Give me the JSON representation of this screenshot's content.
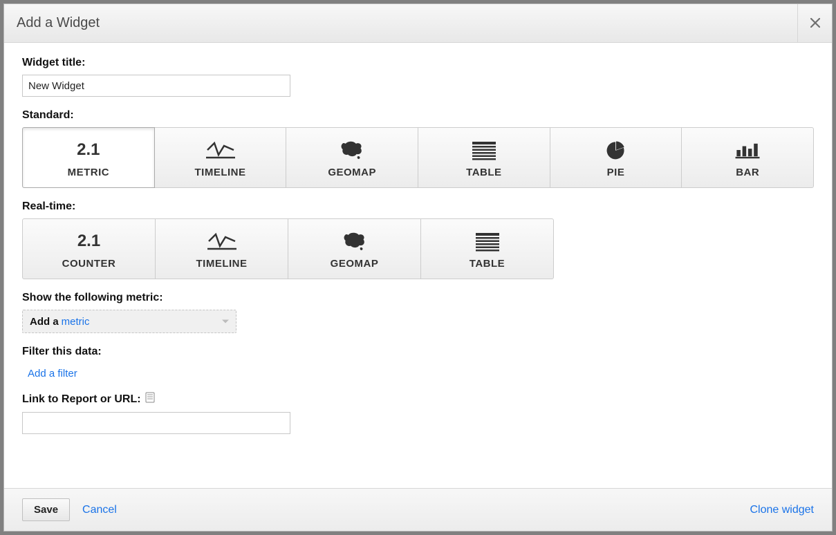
{
  "dialog": {
    "title": "Add a Widget"
  },
  "widget_title": {
    "label": "Widget title:",
    "value": "New Widget"
  },
  "standard": {
    "label": "Standard:",
    "options": {
      "metric": "METRIC",
      "timeline": "TIMELINE",
      "geomap": "GEOMAP",
      "table": "TABLE",
      "pie": "PIE",
      "bar": "BAR"
    },
    "selected": "metric"
  },
  "realtime": {
    "label": "Real-time:",
    "options": {
      "counter": "COUNTER",
      "timeline": "TIMELINE",
      "geomap": "GEOMAP",
      "table": "TABLE"
    }
  },
  "metric": {
    "label": "Show the following metric:",
    "add_prefix": "Add a",
    "add_link": "metric"
  },
  "filter": {
    "label": "Filter this data:",
    "add_filter": "Add a filter"
  },
  "link": {
    "label": "Link to Report or URL:",
    "value": ""
  },
  "footer": {
    "save": "Save",
    "cancel": "Cancel",
    "clone": "Clone widget"
  },
  "icon_num": "2.1"
}
